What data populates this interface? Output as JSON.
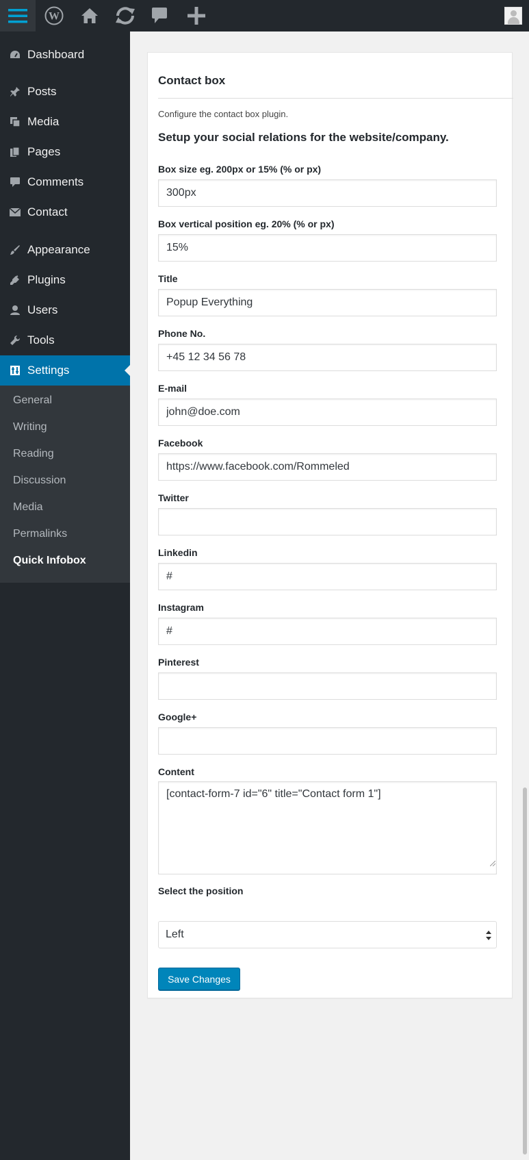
{
  "admin_bar": {
    "icons": [
      "menu-icon",
      "wordpress-logo-icon",
      "home-icon",
      "updates-icon",
      "comments-icon",
      "plus-icon",
      "avatar"
    ]
  },
  "sidebar": {
    "items": [
      {
        "label": "Dashboard",
        "icon": "dashboard-icon"
      },
      {
        "label": "Posts",
        "icon": "pin-icon"
      },
      {
        "label": "Media",
        "icon": "media-icon"
      },
      {
        "label": "Pages",
        "icon": "pages-icon"
      },
      {
        "label": "Comments",
        "icon": "comment-icon"
      },
      {
        "label": "Contact",
        "icon": "mail-icon"
      },
      {
        "label": "Appearance",
        "icon": "brush-icon"
      },
      {
        "label": "Plugins",
        "icon": "plug-icon"
      },
      {
        "label": "Users",
        "icon": "user-icon"
      },
      {
        "label": "Tools",
        "icon": "wrench-icon"
      },
      {
        "label": "Settings",
        "icon": "settings-icon"
      }
    ],
    "submenu": [
      "General",
      "Writing",
      "Reading",
      "Discussion",
      "Media",
      "Permalinks",
      "Quick Infobox"
    ]
  },
  "card": {
    "title": "Contact box",
    "description": "Configure the contact box plugin.",
    "section_heading": "Setup your social relations for the website/company."
  },
  "fields": [
    {
      "label": "Box size eg. 200px or 15% (% or px)",
      "value": "300px"
    },
    {
      "label": "Box vertical position eg. 20% (% or px)",
      "value": "15%"
    },
    {
      "label": "Title",
      "value": "Popup Everything"
    },
    {
      "label": "Phone No.",
      "value": "+45 12 34 56 78"
    },
    {
      "label": "E-mail",
      "value": "john@doe.com"
    },
    {
      "label": "Facebook",
      "value": "https://www.facebook.com/Rommeled"
    },
    {
      "label": "Twitter",
      "value": ""
    },
    {
      "label": "Linkedin",
      "value": "#"
    },
    {
      "label": "Instagram",
      "value": "#"
    },
    {
      "label": "Pinterest",
      "value": ""
    },
    {
      "label": "Google+",
      "value": ""
    }
  ],
  "content_field": {
    "label": "Content",
    "value": "[contact-form-7 id=\"6\" title=\"Contact form 1\"]"
  },
  "position_field": {
    "label": "Select the position",
    "value": "Left"
  },
  "save_label": "Save Changes",
  "colors": {
    "sidebar_bg": "#23282d",
    "submenu_bg": "#32373c",
    "accent": "#0073aa",
    "button": "#0085ba",
    "menu_icon": "#00a0d2"
  }
}
